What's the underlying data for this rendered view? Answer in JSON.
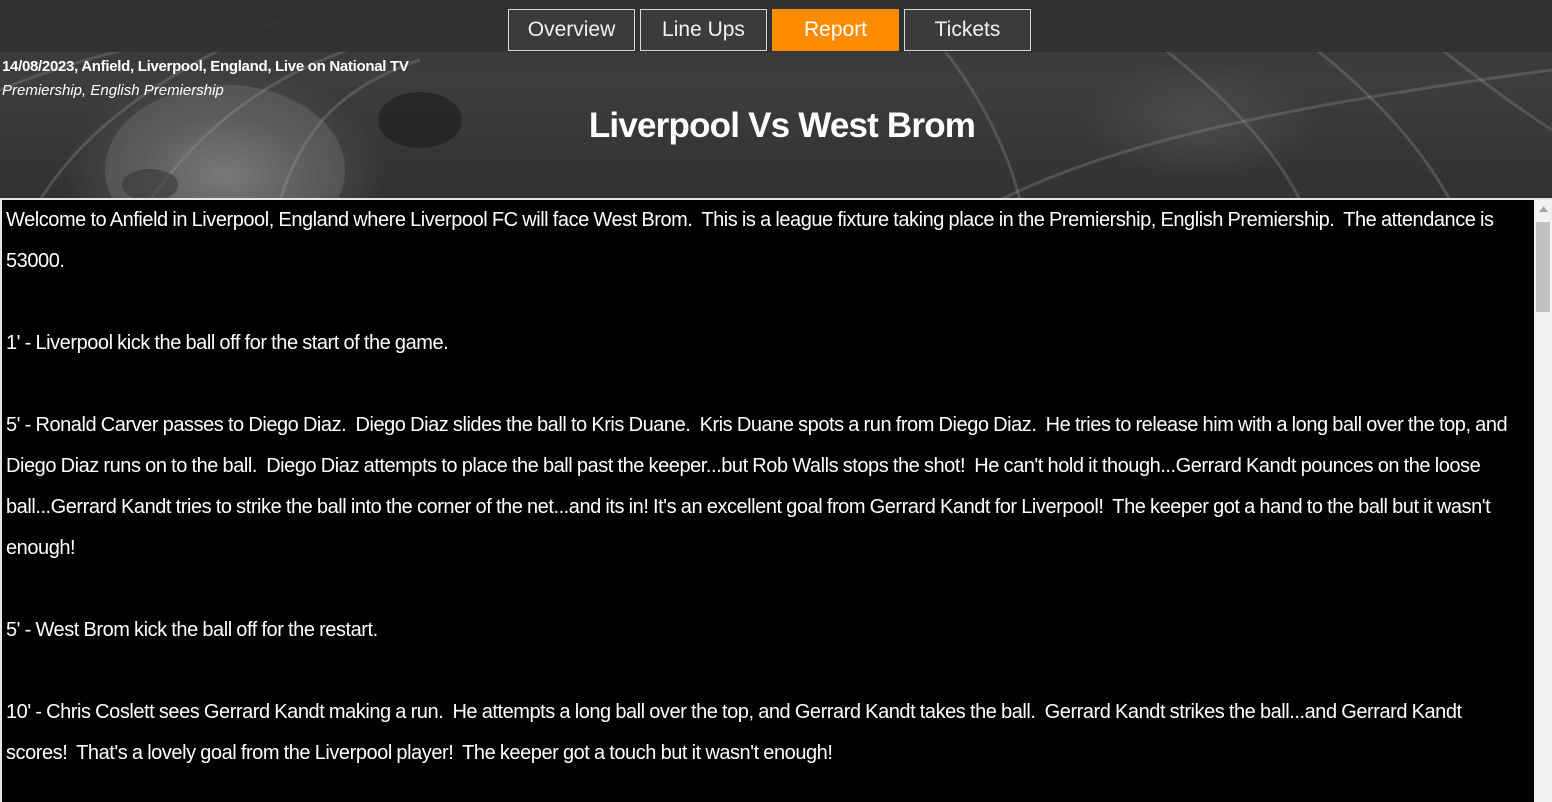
{
  "nav": {
    "tabs": [
      {
        "label": "Overview"
      },
      {
        "label": "Line Ups"
      },
      {
        "label": "Report"
      },
      {
        "label": "Tickets"
      }
    ],
    "active_index": 2,
    "active_color": "#ff8c00"
  },
  "match": {
    "details": "14/08/2023, Anfield, Liverpool, England, Live on National TV",
    "competition": "Premiership, English Premiership",
    "title": "Liverpool Vs West Brom"
  },
  "report": {
    "paragraphs": [
      "Welcome to Anfield in Liverpool, England where Liverpool FC will face West Brom.  This is a league fixture taking place in the Premiership, English Premiership.  The attendance is 53000.",
      "1' - Liverpool kick the ball off for the start of the game.",
      "5' - Ronald Carver passes to Diego Diaz.  Diego Diaz slides the ball to Kris Duane.  Kris Duane spots a run from Diego Diaz.  He tries to release him with a long ball over the top, and Diego Diaz runs on to the ball.  Diego Diaz attempts to place the ball past the keeper...but Rob Walls stops the shot!  He can't hold it though...Gerrard Kandt pounces on the loose ball...Gerrard Kandt tries to strike the ball into the corner of the net...and its in! It's an excellent goal from Gerrard Kandt for Liverpool!  The keeper got a hand to the ball but it wasn't enough!",
      "5' - West Brom kick the ball off for the restart.",
      "10' - Chris Coslett sees Gerrard Kandt making a run.  He attempts a long ball over the top, and Gerrard Kandt takes the ball.  Gerrard Kandt strikes the ball...and Gerrard Kandt scores!  That's a lovely goal from the Liverpool player!  The keeper got a touch but it wasn't enough!"
    ]
  }
}
